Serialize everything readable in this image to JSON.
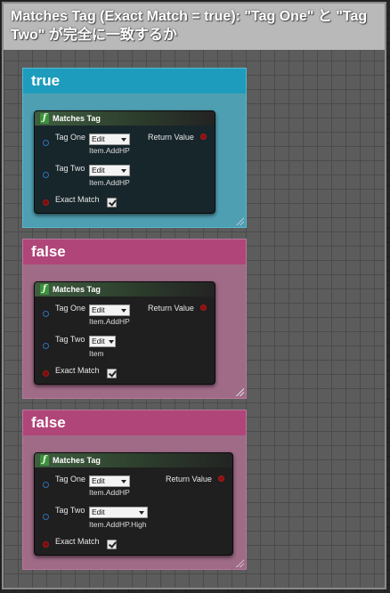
{
  "title": "Matches Tag (Exact Match = true): \"Tag One\" と \"Tag Two\" が完全に一致するか",
  "comments": [
    {
      "header": "true",
      "node": {
        "title": "Matches Tag",
        "tag_one_label": "Tag One",
        "tag_one_dropdown": "Edit",
        "tag_one_value": "Item.AddHP",
        "tag_two_label": "Tag Two",
        "tag_two_dropdown": "Edit",
        "tag_two_value": "Item.AddHP",
        "exact_match_label": "Exact Match",
        "exact_match_checked": true,
        "return_label": "Return Value"
      }
    },
    {
      "header": "false",
      "node": {
        "title": "Matches Tag",
        "tag_one_label": "Tag One",
        "tag_one_dropdown": "Edit",
        "tag_one_value": "Item.AddHP",
        "tag_two_label": "Tag Two",
        "tag_two_dropdown": "Edit",
        "tag_two_value": "Item",
        "exact_match_label": "Exact Match",
        "exact_match_checked": true,
        "return_label": "Return Value"
      }
    },
    {
      "header": "false",
      "node": {
        "title": "Matches Tag",
        "tag_one_label": "Tag One",
        "tag_one_dropdown": "Edit",
        "tag_one_value": "Item.AddHP",
        "tag_two_label": "Tag Two",
        "tag_two_dropdown": "Edit",
        "tag_two_value": "Item.AddHP.High",
        "exact_match_label": "Exact Match",
        "exact_match_checked": true,
        "return_label": "Return Value"
      }
    }
  ],
  "colors": {
    "true_header": "#1e9cbd",
    "false_header": "#b04579",
    "function_icon": "#3e8f3e"
  },
  "icons": {
    "function": "function-icon",
    "checkbox": "checkbox-checked-icon",
    "resize": "resize-grip-icon"
  }
}
